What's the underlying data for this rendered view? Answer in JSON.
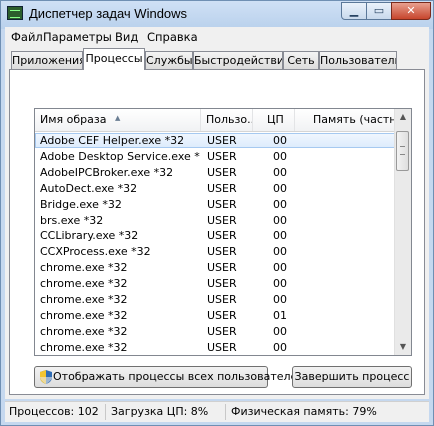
{
  "window": {
    "title": "Диспетчер задач Windows"
  },
  "menu": [
    "Файл",
    "Параметры",
    "Вид",
    "Справка"
  ],
  "tabs": [
    "Приложения",
    "Процессы",
    "Службы",
    "Быстродействие",
    "Сеть",
    "Пользователи"
  ],
  "active_tab": "Процессы",
  "columns": [
    "Имя образа",
    "Пользо...",
    "ЦП",
    "Память (частный"
  ],
  "processes": [
    {
      "name": "Adobe CEF Helper.exe *32",
      "user": "USER",
      "cpu": "00"
    },
    {
      "name": "Adobe Desktop Service.exe *32",
      "user": "USER",
      "cpu": "00"
    },
    {
      "name": "AdobeIPCBroker.exe *32",
      "user": "USER",
      "cpu": "00"
    },
    {
      "name": "AutoDect.exe *32",
      "user": "USER",
      "cpu": "00"
    },
    {
      "name": "Bridge.exe *32",
      "user": "USER",
      "cpu": "00"
    },
    {
      "name": "brs.exe *32",
      "user": "USER",
      "cpu": "00"
    },
    {
      "name": "CCLibrary.exe *32",
      "user": "USER",
      "cpu": "00"
    },
    {
      "name": "CCXProcess.exe *32",
      "user": "USER",
      "cpu": "00"
    },
    {
      "name": "chrome.exe *32",
      "user": "USER",
      "cpu": "00"
    },
    {
      "name": "chrome.exe *32",
      "user": "USER",
      "cpu": "00"
    },
    {
      "name": "chrome.exe *32",
      "user": "USER",
      "cpu": "00"
    },
    {
      "name": "chrome.exe *32",
      "user": "USER",
      "cpu": "01"
    },
    {
      "name": "chrome.exe *32",
      "user": "USER",
      "cpu": "00"
    },
    {
      "name": "chrome.exe *32",
      "user": "USER",
      "cpu": "00"
    }
  ],
  "selected_row": 0,
  "buttons": {
    "show_all": "Отображать процессы всех пользователей",
    "end_process": "Завершить процесс"
  },
  "status": {
    "processes": "Процессов: 102",
    "cpu": "Загрузка ЦП: 8%",
    "memory": "Физическая память: 79%"
  },
  "icons": {
    "app": "task-manager-icon",
    "shield": "uac-shield-icon"
  }
}
